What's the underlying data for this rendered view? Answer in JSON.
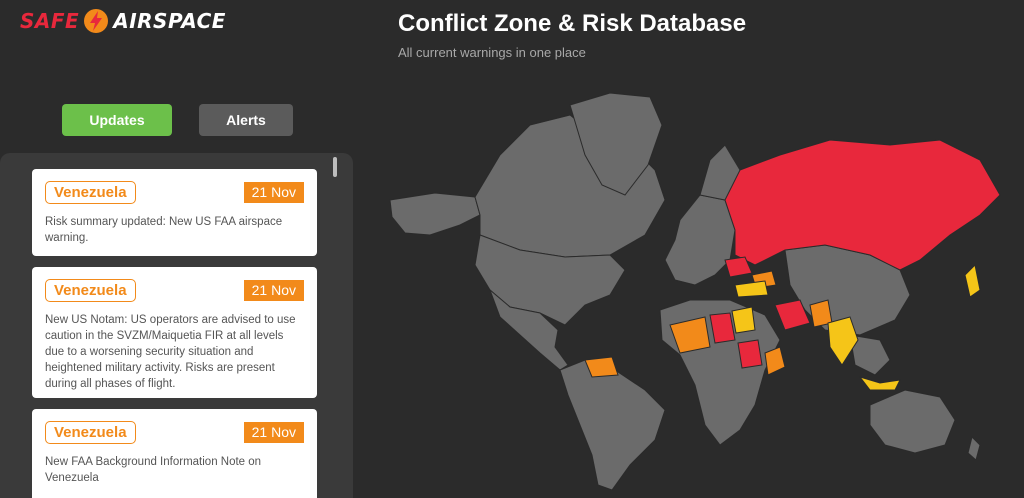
{
  "brand": {
    "name_left": "SAFE",
    "name_right": "AIRSPACE",
    "colors": {
      "red": "#e8283c",
      "orange": "#f28a1a",
      "green": "#6cc04a"
    }
  },
  "header": {
    "title": "Conflict Zone & Risk Database",
    "subtitle": "All current warnings in one place"
  },
  "tabs": {
    "updates": "Updates",
    "alerts": "Alerts",
    "active": "Updates"
  },
  "updates": [
    {
      "country": "Venezuela",
      "date": "21 Nov",
      "text": "Risk summary updated: New US FAA airspace warning."
    },
    {
      "country": "Venezuela",
      "date": "21 Nov",
      "text": "New US Notam: US operators are advised to use caution in the SVZM/Maiquetia FIR at all levels due to a worsening security situation and heightened military activity. Risks are present during all phases of flight."
    },
    {
      "country": "Venezuela",
      "date": "21 Nov",
      "text": "New FAA Background Information Note on Venezuela"
    }
  ],
  "map": {
    "risk_colors": {
      "high": "#e8283c",
      "medium": "#f28a1a",
      "low": "#f5c518",
      "none": "#6b6b6b"
    },
    "ocean_color": "#2b2b2b"
  }
}
